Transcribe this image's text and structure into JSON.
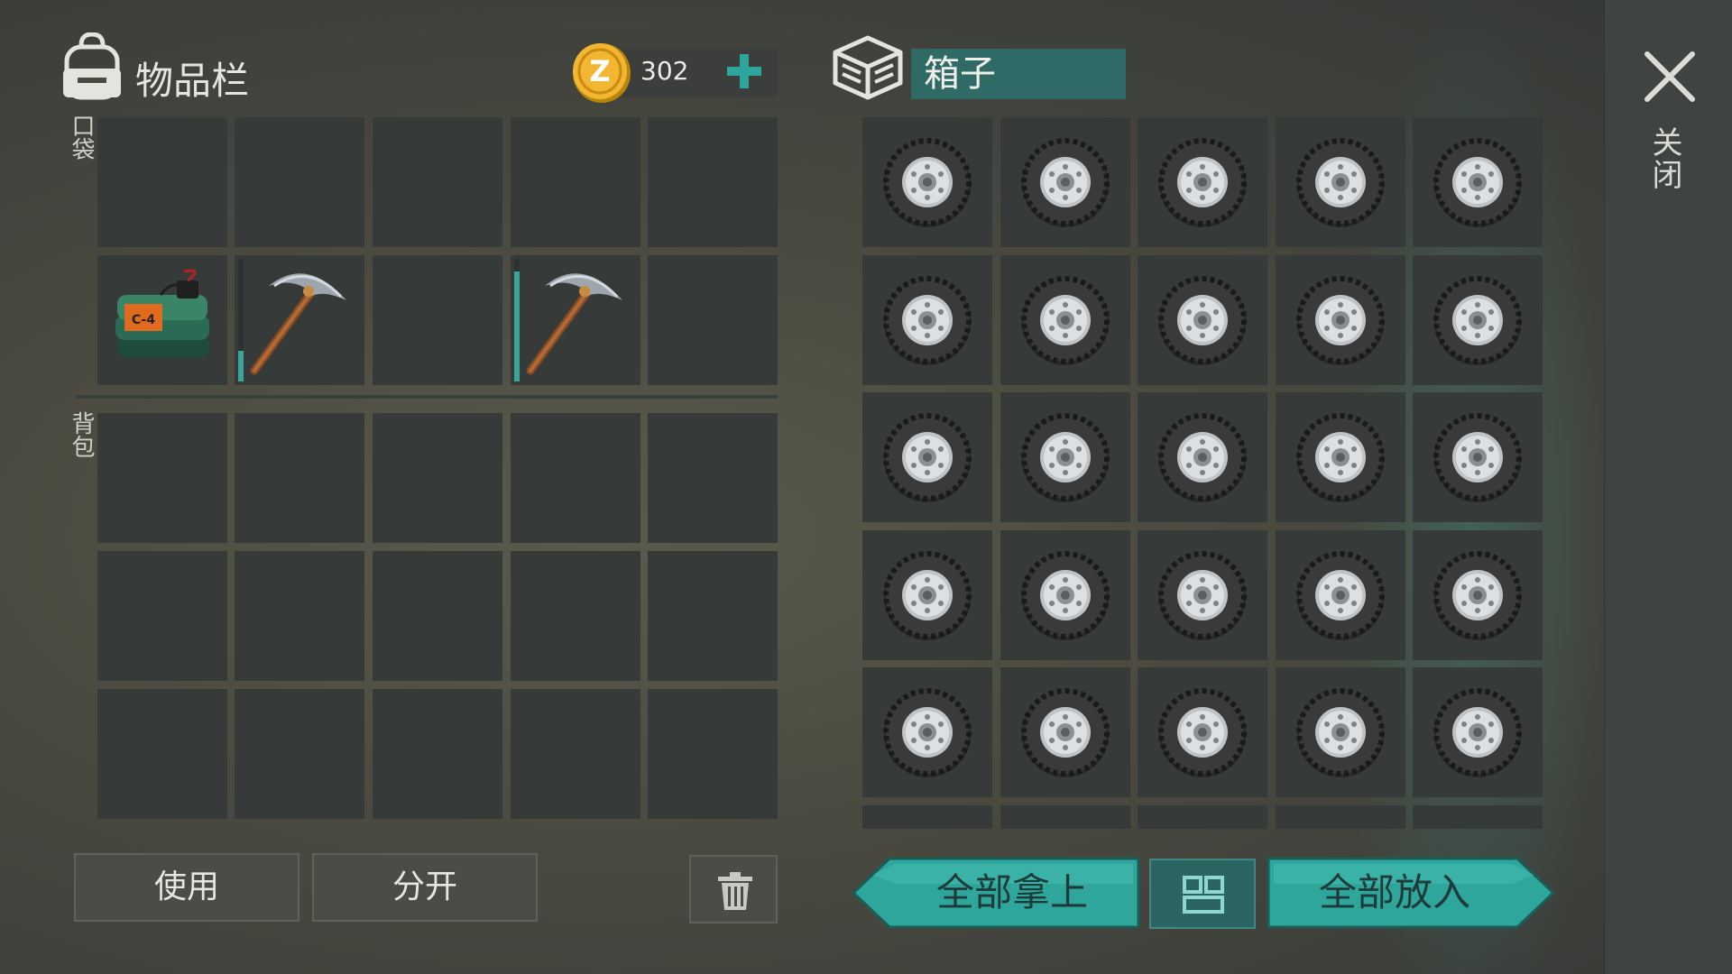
{
  "inventory": {
    "title": "物品栏",
    "currency_value": "302",
    "pocket_label": "口袋",
    "backpack_label": "背包",
    "pocket_slots": [
      {
        "item": ""
      },
      {
        "item": ""
      },
      {
        "item": ""
      },
      {
        "item": ""
      },
      {
        "item": ""
      },
      {
        "item": "c4-explosive-icon"
      },
      {
        "item": "pickaxe-icon",
        "durability": 0.25
      },
      {
        "item": ""
      },
      {
        "item": "pickaxe-icon",
        "durability": 0.9
      },
      {
        "item": ""
      }
    ],
    "c4_label": "C-4"
  },
  "container": {
    "title": "箱子",
    "item_icon": "tire-icon",
    "rows_visible": 5,
    "cols": 5
  },
  "buttons": {
    "use": "使用",
    "split": "分开",
    "take_all": "全部拿上",
    "put_all": "全部放入"
  },
  "close_label": "关闭",
  "colors": {
    "accent": "#2fa69c",
    "slot": "#363b39",
    "title_bar": "#2f6a66"
  }
}
